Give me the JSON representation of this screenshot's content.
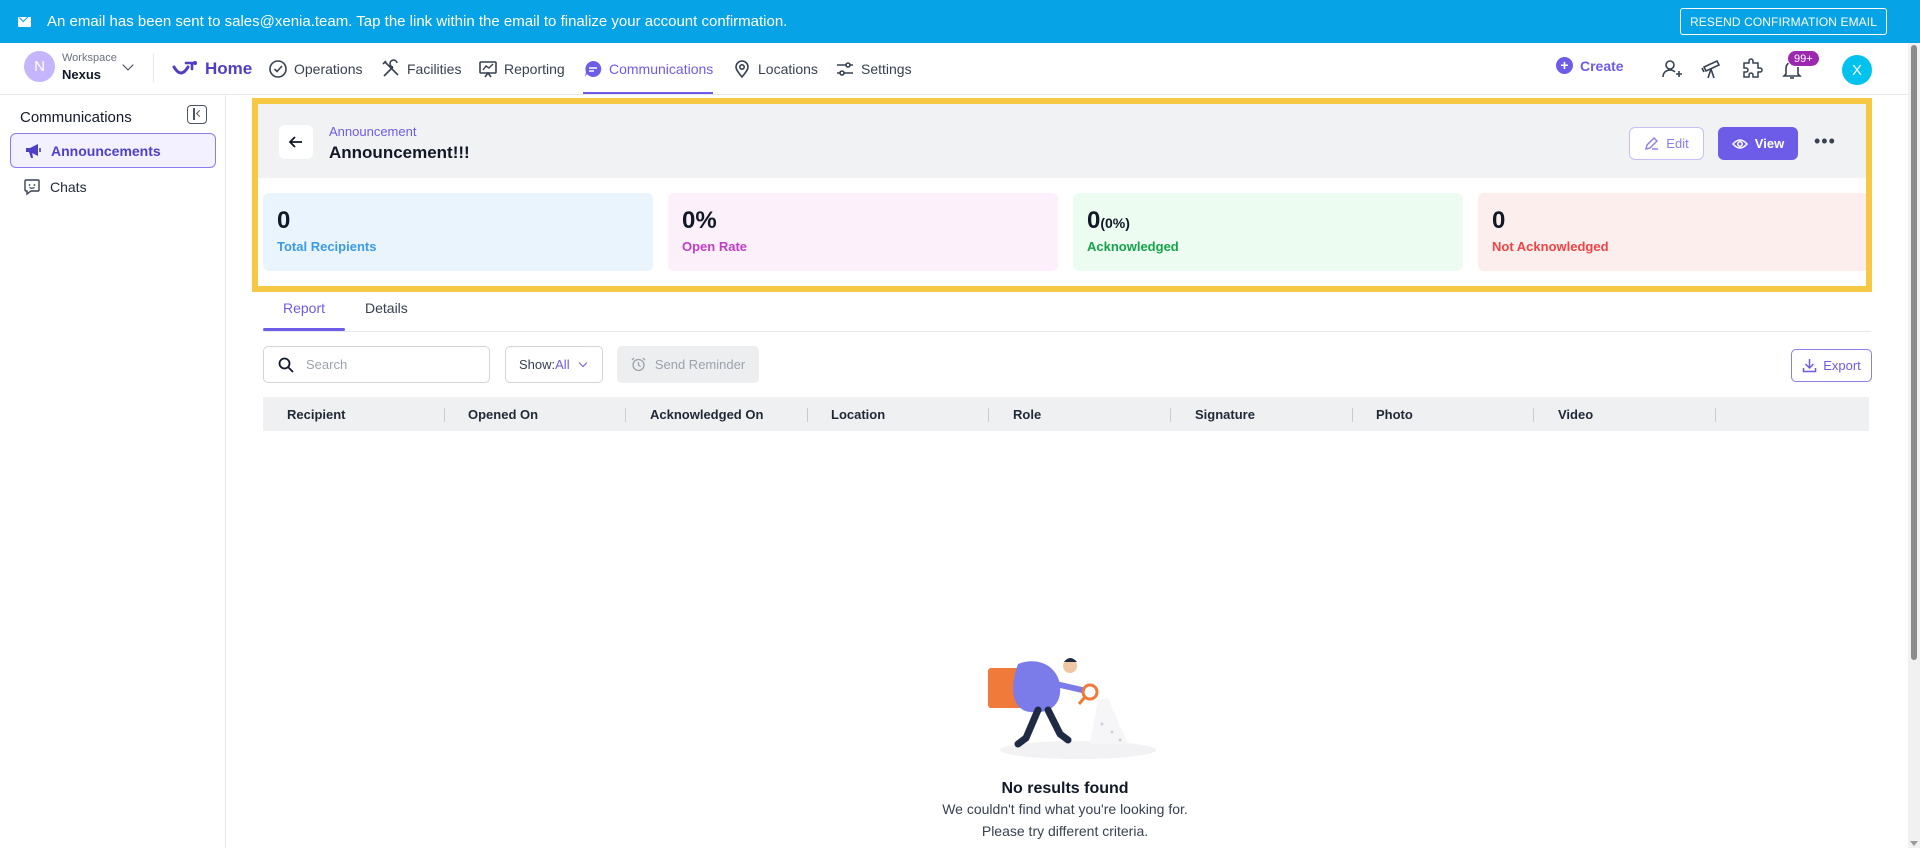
{
  "banner": {
    "message": "An email has been sent to sales@xenia.team. Tap the link within the email to finalize your account confirmation.",
    "resend_label": "RESEND CONFIRMATION EMAIL"
  },
  "workspace": {
    "label": "Workspace",
    "name": "Nexus",
    "initial": "N"
  },
  "nav": {
    "home": "Home",
    "operations": "Operations",
    "facilities": "Facilities",
    "reporting": "Reporting",
    "communications": "Communications",
    "locations": "Locations",
    "settings": "Settings",
    "active": "communications"
  },
  "header_actions": {
    "create": "Create",
    "notifications_badge": "99+",
    "user_initial": "X"
  },
  "sidebar": {
    "title": "Communications",
    "items": [
      {
        "label": "Announcements",
        "active": true,
        "icon": "megaphone-icon"
      },
      {
        "label": "Chats",
        "active": false,
        "icon": "chat-icon"
      }
    ]
  },
  "announcement": {
    "breadcrumb": "Announcement",
    "title": "Announcement!!!",
    "edit_label": "Edit",
    "view_label": "View",
    "more_label": "•••"
  },
  "stats": [
    {
      "value": "0",
      "sub": "",
      "label": "Total Recipients",
      "bg": "#eaf4fd",
      "color": "#3b9be8"
    },
    {
      "value": "0%",
      "sub": "",
      "label": "Open Rate",
      "bg": "#fcf0fb",
      "color": "#c23cc6"
    },
    {
      "value": "0",
      "sub": "(0%)",
      "label": "Acknowledged",
      "bg": "#ecfcf1",
      "color": "#16a34a"
    },
    {
      "value": "0",
      "sub": "",
      "label": "Not Acknowledged",
      "bg": "#fdeeee",
      "color": "#ef4444"
    }
  ],
  "tabs": {
    "report": "Report",
    "details": "Details",
    "active": "report"
  },
  "toolbar": {
    "search_placeholder": "Search",
    "show_label": "Show:",
    "show_value": "All",
    "reminder_label": "Send Reminder",
    "export_label": "Export"
  },
  "table": {
    "columns": [
      "Recipient",
      "Opened On",
      "Acknowledged On",
      "Location",
      "Role",
      "Signature",
      "Photo",
      "Video"
    ],
    "rows": []
  },
  "empty_state": {
    "title": "No results found",
    "line1": "We couldn't find what you're looking for.",
    "line2": "Please try different criteria."
  },
  "colors": {
    "accent": "#6d5ce8",
    "banner": "#06a3e6",
    "highlight": "#f7c843"
  }
}
